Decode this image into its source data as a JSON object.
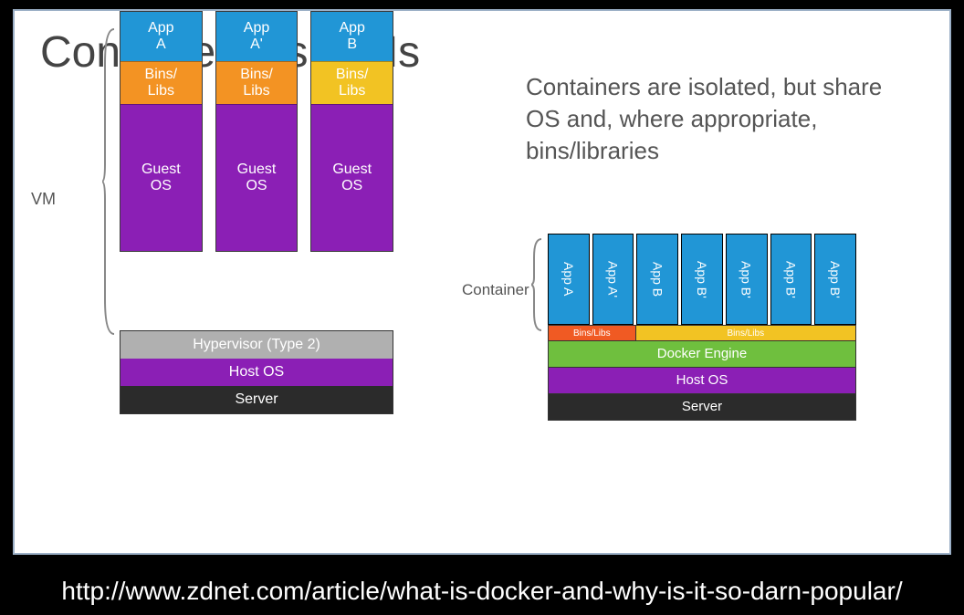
{
  "title": "Containers vs. VMs",
  "vm_label": "VM",
  "vm_columns": [
    {
      "app": "App\nA",
      "bins": "Bins/\nLibs",
      "bins_variant": "orange",
      "guest": "Guest\nOS"
    },
    {
      "app": "App\nA'",
      "bins": "Bins/\nLibs",
      "bins_variant": "orange",
      "guest": "Guest\nOS"
    },
    {
      "app": "App\nB",
      "bins": "Bins/\nLibs",
      "bins_variant": "yellow",
      "guest": "Guest\nOS"
    }
  ],
  "vm_base": {
    "hypervisor": "Hypervisor (Type 2)",
    "host": "Host OS",
    "server": "Server"
  },
  "description": "Containers are isolated, but share OS and, where appropriate, bins/libraries",
  "container_label": "Container",
  "container_apps": [
    "App A",
    "App A'",
    "App B",
    "App B'",
    "App B'",
    "App B'",
    "App B'"
  ],
  "container_bins": {
    "left": "Bins/Libs",
    "right": "Bins/Libs"
  },
  "container_base": {
    "docker": "Docker Engine",
    "host": "Host OS",
    "server": "Server"
  },
  "footer_url": "http://www.zdnet.com/article/what-is-docker-and-why-is-it-so-darn-popular/",
  "colors": {
    "app": "#2196d6",
    "bins_orange": "#f39323",
    "bins_yellow": "#f2c323",
    "guest_host": "#8b1fb5",
    "hypervisor": "#b0b0b0",
    "server": "#2b2b2b",
    "docker": "#6fbf3e",
    "bins_red": "#f05a23"
  }
}
